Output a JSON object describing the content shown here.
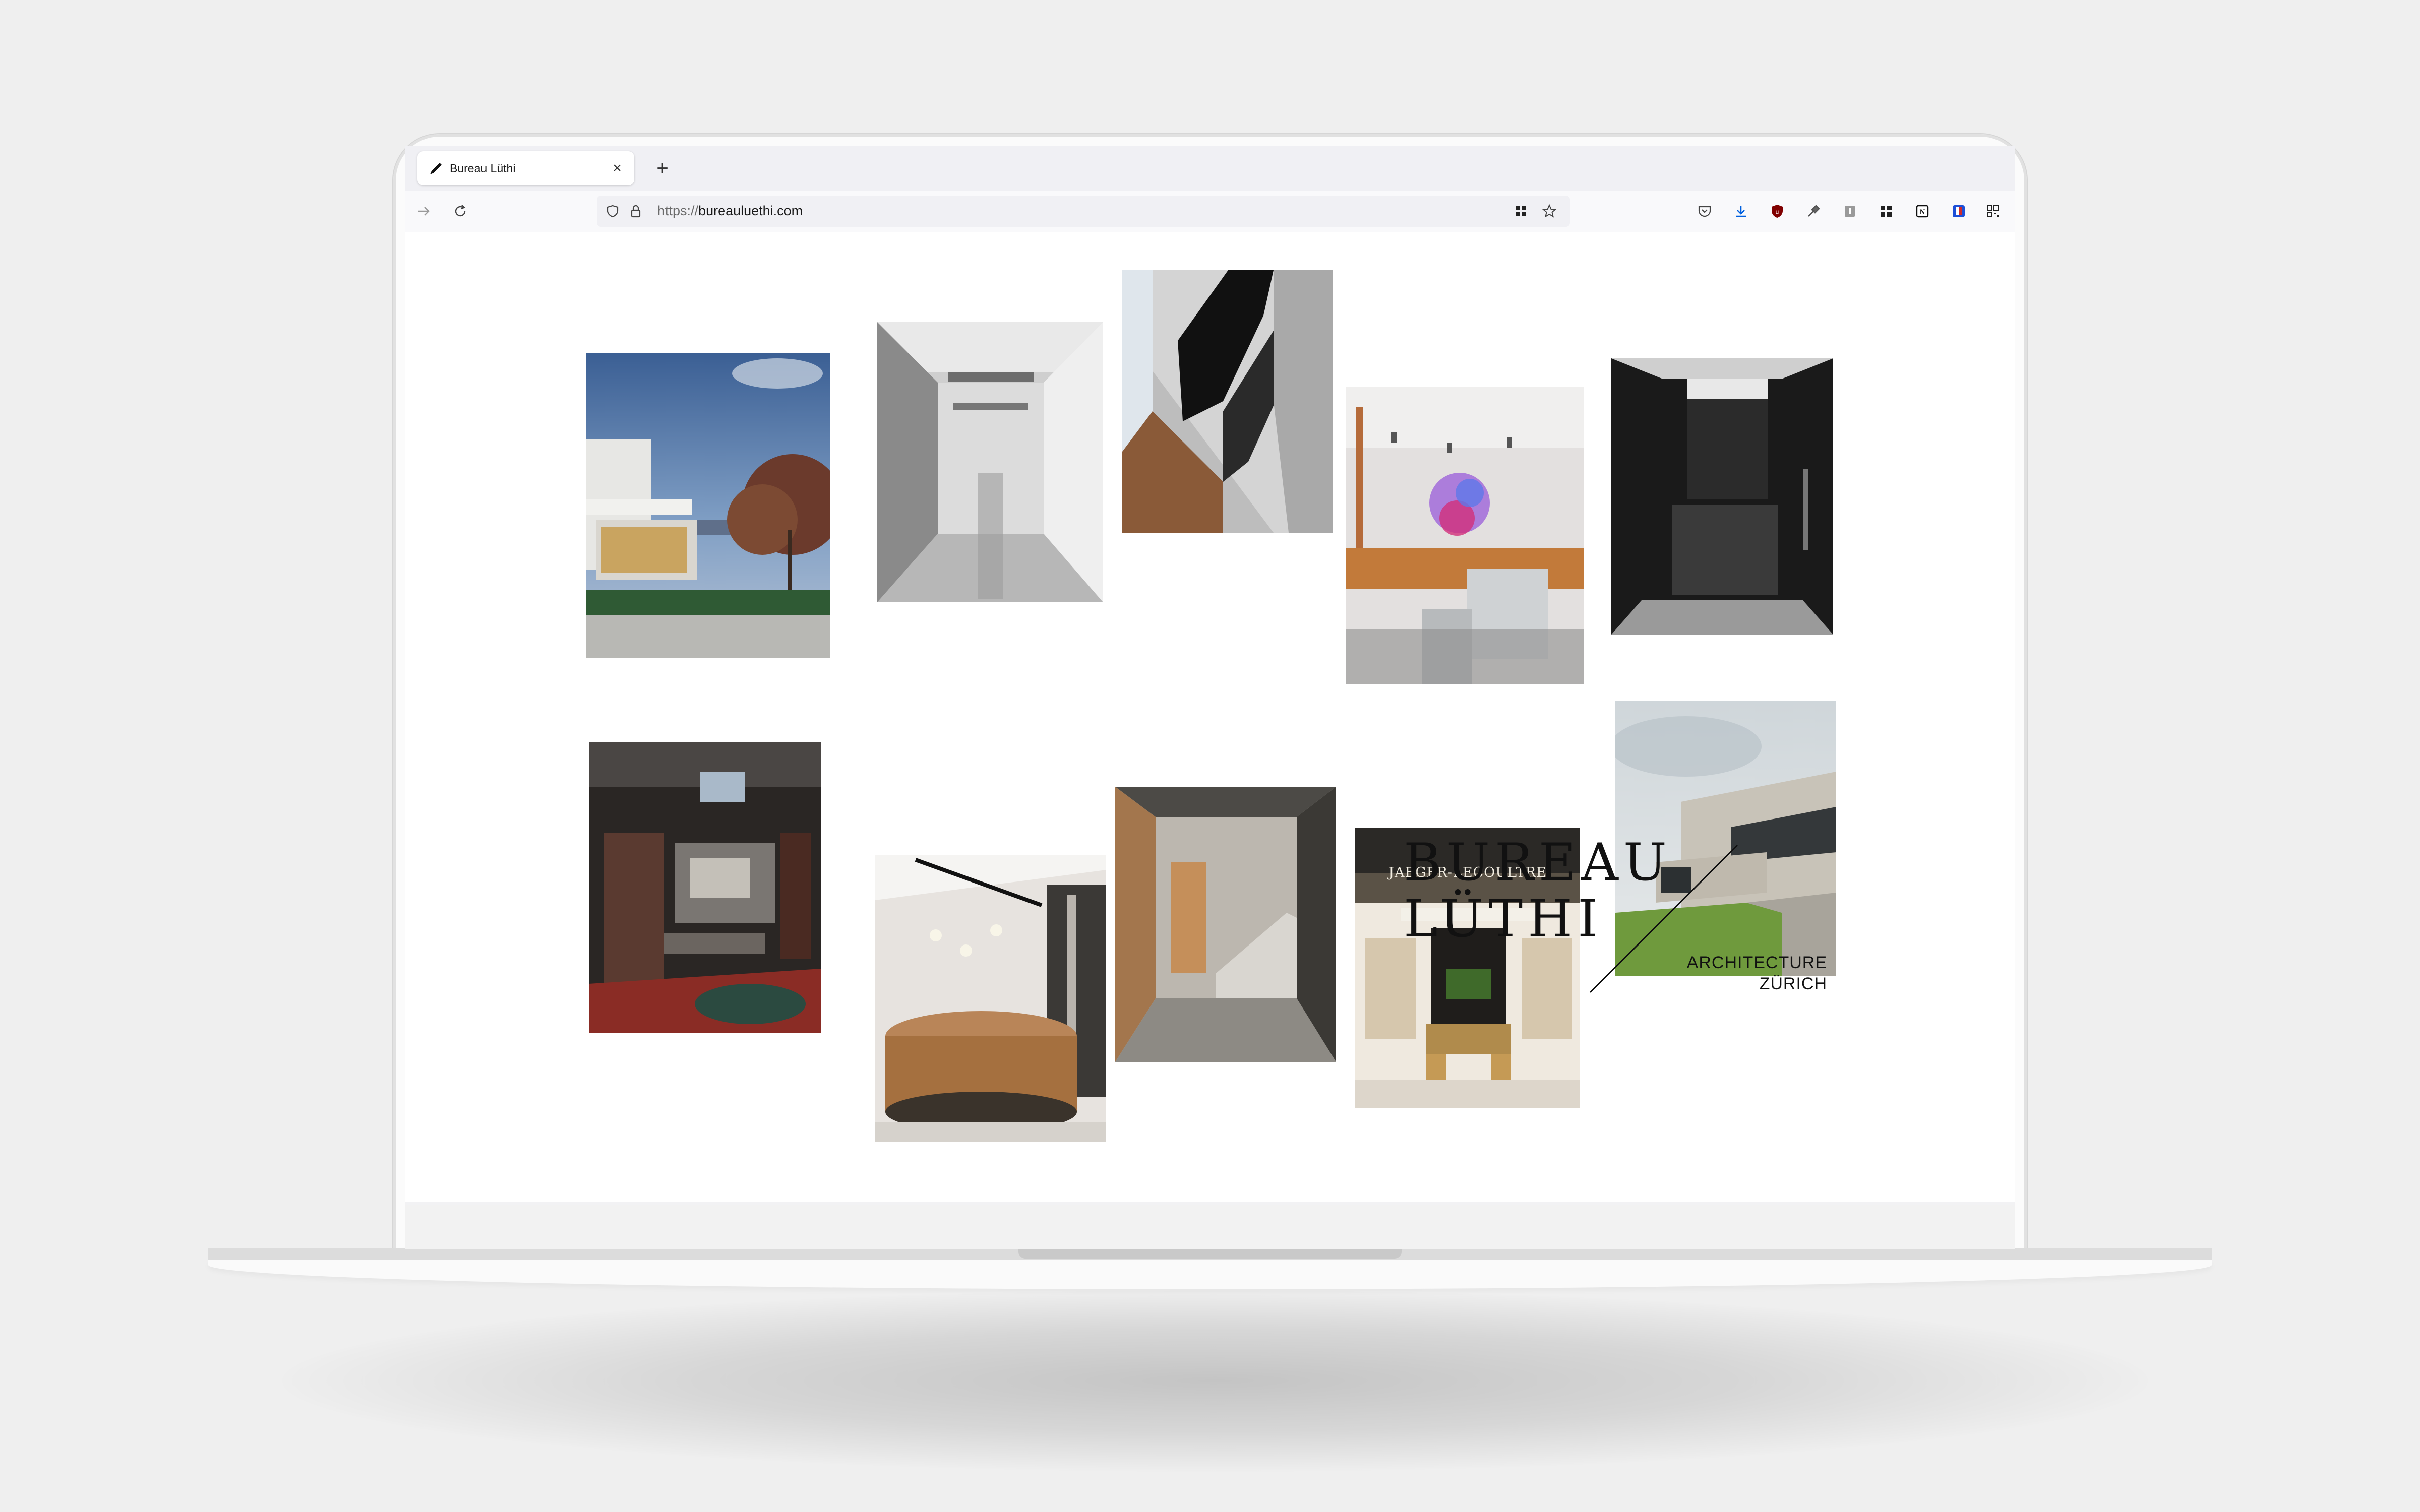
{
  "browser": {
    "tab_title": "Bureau Lüthi",
    "tab_close": "×",
    "new_tab": "+",
    "url_scheme": "https://",
    "url_host": "bureauluethi.com"
  },
  "site": {
    "brand_line1": "BUREAU",
    "brand_line2": "LÜTHI",
    "tagline_line1": "ARCHITECTURE",
    "tagline_line2": "ZÜRICH",
    "store_sign": "JAEGER-LECOULTRE"
  },
  "icons": [
    "pen-icon",
    "close-icon",
    "plus-icon",
    "forward-arrow-icon",
    "reload-icon",
    "shield-icon",
    "lock-icon",
    "grid-icon",
    "star-icon",
    "pocket-icon",
    "download-icon",
    "ublock-icon",
    "eyedropper-icon",
    "extension-icon",
    "apps-icon",
    "notion-icon",
    "bitwarden-icon",
    "qr-icon"
  ],
  "colors": {
    "accent_blue": "#0060df",
    "ublock_red": "#800000",
    "background": "#efefef"
  }
}
